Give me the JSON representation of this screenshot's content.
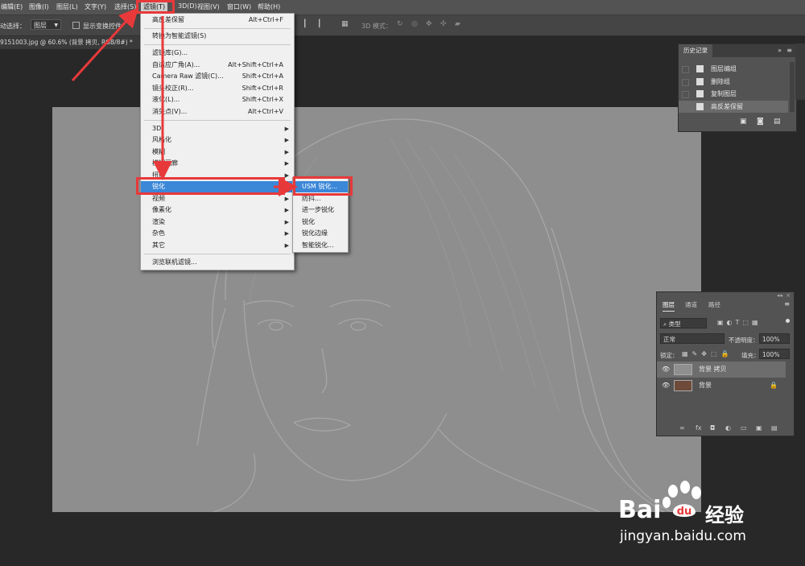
{
  "menubar": {
    "items": [
      "编辑(E)",
      "图像(I)",
      "图层(L)",
      "文字(Y)",
      "选择(S)",
      "滤镜(T)",
      "3D(D)",
      "视图(V)",
      "窗口(W)",
      "帮助(H)"
    ]
  },
  "options": {
    "auto_select_label": "动选择：",
    "auto_select_value": "图层",
    "show_transform_label": "显示变换控件",
    "mode_3d_label": "3D 模式："
  },
  "document": {
    "tab_title": "9151003.jpg @ 60.6% (背景 拷贝, RGB/8#) *"
  },
  "filter_menu": {
    "items": [
      {
        "label": "高反差保留",
        "shortcut": "Alt+Ctrl+F"
      },
      {
        "label": "转换为智能滤镜(S)"
      },
      {
        "label": "滤镜库(G)..."
      },
      {
        "label": "自适应广角(A)...",
        "shortcut": "Alt+Shift+Ctrl+A"
      },
      {
        "label": "Camera Raw 滤镜(C)...",
        "shortcut": "Shift+Ctrl+A"
      },
      {
        "label": "镜头校正(R)...",
        "shortcut": "Shift+Ctrl+R"
      },
      {
        "label": "液化(L)...",
        "shortcut": "Shift+Ctrl+X"
      },
      {
        "label": "消失点(V)...",
        "shortcut": "Alt+Ctrl+V"
      },
      {
        "label": "3D"
      },
      {
        "label": "风格化"
      },
      {
        "label": "模糊"
      },
      {
        "label": "模糊画廊"
      },
      {
        "label": "扭曲"
      },
      {
        "label": "锐化"
      },
      {
        "label": "视频"
      },
      {
        "label": "像素化"
      },
      {
        "label": "渲染"
      },
      {
        "label": "杂色"
      },
      {
        "label": "其它"
      },
      {
        "label": "浏览联机滤镜..."
      }
    ]
  },
  "sharpen_submenu": {
    "items": [
      "USM 锐化...",
      "防抖...",
      "进一步锐化",
      "锐化",
      "锐化边缘",
      "智能锐化..."
    ]
  },
  "history_panel": {
    "title": "历史记录",
    "items": [
      "图层编组",
      "删除组",
      "复制图层",
      "高反差保留"
    ]
  },
  "layers_panel": {
    "tabs": [
      "图层",
      "通道",
      "路径"
    ],
    "filter_kind": "类型",
    "blend_mode": "正常",
    "opacity_label": "不透明度：",
    "opacity_value": "100%",
    "lock_label": "锁定：",
    "fill_label": "填充：",
    "fill_value": "100%",
    "layers": [
      {
        "name": "背景 拷贝"
      },
      {
        "name": "背景"
      }
    ]
  },
  "watermark": {
    "logo_text": "Bai",
    "logo_suffix": "经验",
    "url": "jingyan.baidu.com"
  },
  "colors": {
    "accent_red": "#e8393a",
    "highlight_blue": "#3b87d8"
  }
}
